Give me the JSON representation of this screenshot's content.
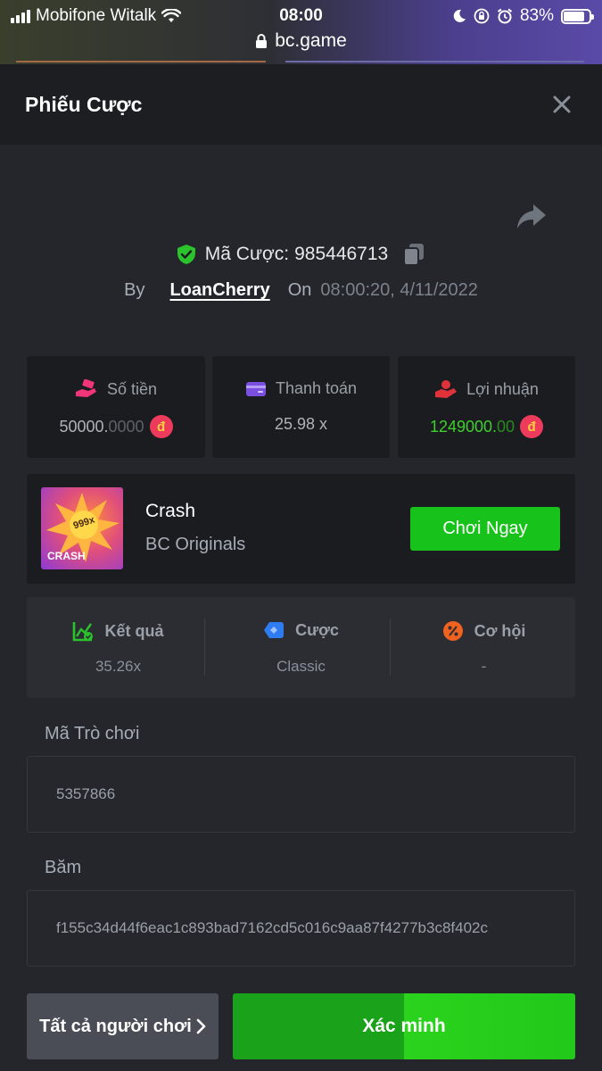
{
  "status_bar": {
    "carrier": "Mobifone Witalk",
    "time": "08:00",
    "battery": "83%",
    "battery_level": 0.83,
    "url": "bc.game"
  },
  "header": {
    "title": "Phiếu Cược"
  },
  "bet": {
    "id_label": "Mã Cược:",
    "id_value": "985446713",
    "by_label": "By",
    "username": "LoanCherry",
    "on_label": "On",
    "timestamp": "08:00:20, 4/11/2022"
  },
  "stats": {
    "amount": {
      "label": "Số tiền",
      "value_main": "50000.",
      "value_dim": "0000"
    },
    "payout": {
      "label": "Thanh toán",
      "value": "25.98 x"
    },
    "profit": {
      "label": "Lợi nhuận",
      "value_main": "1249000.",
      "value_dim": "00"
    },
    "currency_symbol": "đ"
  },
  "game": {
    "name": "Crash",
    "provider": "BC Originals",
    "thumb_text": "CRASH",
    "thumb_badge": "999x",
    "play_label": "Chơi Ngay"
  },
  "info": {
    "result": {
      "label": "Kết quả",
      "value": "35.26x"
    },
    "bet_type": {
      "label": "Cược",
      "value": "Classic"
    },
    "chance": {
      "label": "Cơ hội",
      "value": "-"
    }
  },
  "game_id": {
    "label": "Mã Trò chơi",
    "value": "5357866"
  },
  "hash": {
    "label": "Băm",
    "value": "f155c34d44f6eac1c893bad7162cd5c016c9aa87f4277b3c8f402c"
  },
  "buttons": {
    "all_players": "Tất cả người chơi",
    "verify": "Xác minh"
  },
  "colors": {
    "accent_green": "#17c31a",
    "profit_green": "#3ed02a",
    "coin_red": "#ef3b5b",
    "background": "#24262b"
  }
}
